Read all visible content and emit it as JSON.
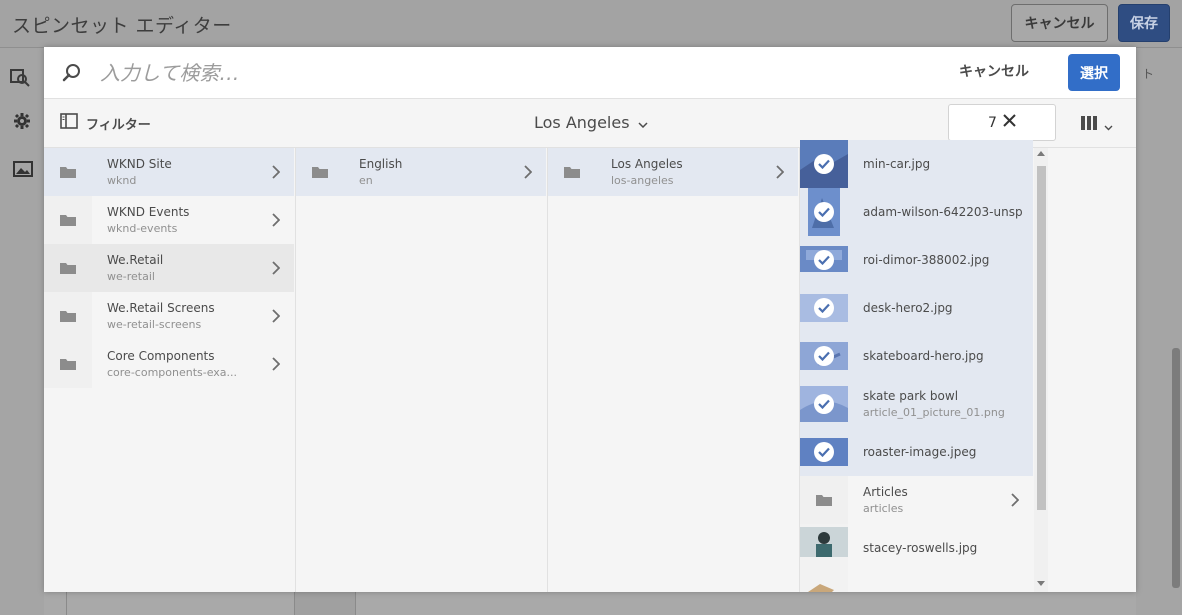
{
  "background": {
    "title": "スピンセット エディター",
    "cancel_label": "キャンセル",
    "save_label": "保存",
    "right_text": "ト"
  },
  "search": {
    "placeholder": "入力して検索…",
    "cancel_label": "キャンセル",
    "select_label": "選択"
  },
  "toolbar": {
    "filter_label": "フィルター",
    "breadcrumb": "Los Angeles",
    "selected_count": "7"
  },
  "columns": {
    "col1": [
      {
        "title": "WKND Site",
        "name": "wknd"
      },
      {
        "title": "WKND Events",
        "name": "wknd-events"
      },
      {
        "title": "We.Retail",
        "name": "we-retail"
      },
      {
        "title": "We.Retail Screens",
        "name": "we-retail-screens"
      },
      {
        "title": "Core Components",
        "name": "core-components-exa..."
      }
    ],
    "col2": [
      {
        "title": "English",
        "name": "en"
      }
    ],
    "col3": [
      {
        "title": "Los Angeles",
        "name": "los-angeles"
      }
    ],
    "col4": [
      {
        "title": "min-car.jpg"
      },
      {
        "title": "adam-wilson-642203-unsp..."
      },
      {
        "title": "roi-dimor-388002.jpg"
      },
      {
        "title": "desk-hero2.jpg"
      },
      {
        "title": "skateboard-hero.jpg"
      },
      {
        "title": "skate park bowl",
        "name": "article_01_picture_01.png"
      },
      {
        "title": "roaster-image.jpeg"
      },
      {
        "title": "Articles",
        "name": "articles"
      },
      {
        "title": "stacey-roswells.jpg"
      }
    ]
  },
  "colors": {
    "accent": "#326ec8",
    "selected_row": "#e3e8f1",
    "thumb_selected": "#5c87cf"
  }
}
